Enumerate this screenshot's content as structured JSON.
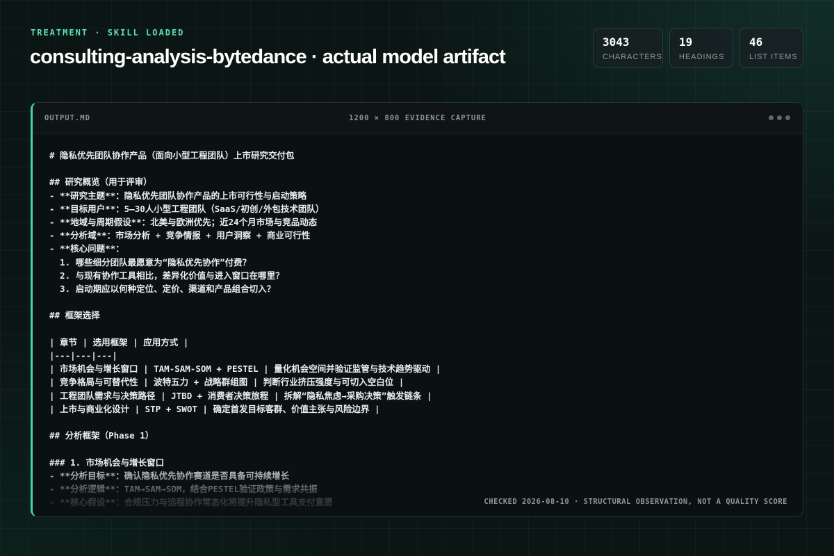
{
  "header": {
    "eyebrow": "TREATMENT · SKILL LOADED",
    "title": "consulting-analysis-bytedance · actual model artifact"
  },
  "stats": [
    {
      "value": "3043",
      "label": "CHARACTERS"
    },
    {
      "value": "19",
      "label": "HEADINGS"
    },
    {
      "value": "46",
      "label": "LIST ITEMS"
    }
  ],
  "panel": {
    "file_name": "OUTPUT.MD",
    "capture_label": "1200 × 800 EVIDENCE CAPTURE",
    "menu_icon": "more-dots-icon",
    "accent_color": "#43d6a6",
    "footer_note": "CHECKED 2026-08-10 · STRUCTURAL OBSERVATION, NOT A QUALITY SCORE",
    "content_lines": [
      "# 隐私优先团队协作产品（面向小型工程团队）上市研究交付包",
      "",
      "## 研究概览（用于评审）",
      "- **研究主题**：隐私优先团队协作产品的上市可行性与启动策略",
      "- **目标用户**：5–30人小型工程团队（SaaS/初创/外包技术团队）",
      "- **地域与周期假设**：北美与欧洲优先；近24个月市场与竞品动态",
      "- **分析域**：市场分析 + 竞争情报 + 用户洞察 + 商业可行性",
      "- **核心问题**：",
      "  1. 哪些细分团队最愿意为“隐私优先协作”付费？",
      "  2. 与现有协作工具相比，差异化价值与进入窗口在哪里？",
      "  3. 启动期应以何种定位、定价、渠道和产品组合切入？",
      "",
      "## 框架选择",
      "",
      "| 章节 | 选用框架 | 应用方式 |",
      "|---|---|---|",
      "| 市场机会与增长窗口 | TAM-SAM-SOM + PESTEL | 量化机会空间并验证监管与技术趋势驱动 |",
      "| 竞争格局与可替代性 | 波特五力 + 战略群组图 | 判断行业挤压强度与可切入空白位 |",
      "| 工程团队需求与决策路径 | JTBD + 消费者决策旅程 | 拆解“隐私焦虑→采购决策”触发链条 |",
      "| 上市与商业化设计 | STP + SWOT | 确定首发目标客群、价值主张与风险边界 |",
      "",
      "## 分析框架（Phase 1）",
      "",
      "### 1. 市场机会与增长窗口",
      "- **分析目标**：确认隐私优先协作赛道是否具备可持续增长",
      "- **分析逻辑**：TAM→SAM→SOM，结合PESTEL验证政策与需求共振",
      "- **核心假设**：合规压力与远程协作常态化将提升隐私型工具支付意愿"
    ]
  }
}
